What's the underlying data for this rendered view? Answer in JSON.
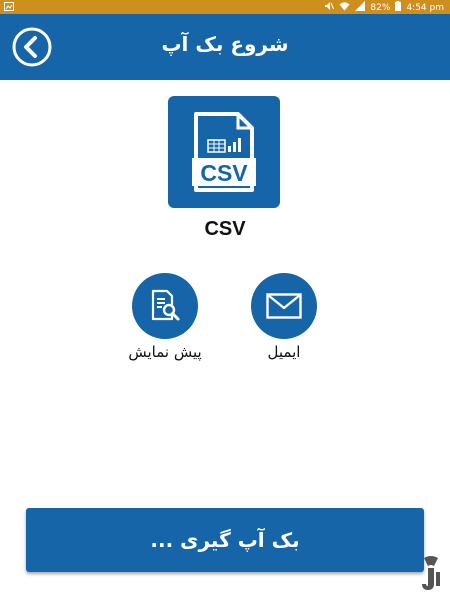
{
  "status_bar": {
    "battery": "82%",
    "time": "4:54 pm"
  },
  "header": {
    "title": "شروع بک آپ",
    "back_icon": "back-arrow-icon"
  },
  "file": {
    "icon": "csv-file-icon",
    "type_label": "CSV"
  },
  "actions": [
    {
      "id": "preview",
      "icon": "document-search-icon",
      "label": "پیش نمایش"
    },
    {
      "id": "email",
      "icon": "envelope-icon",
      "label": "ایمیل"
    }
  ],
  "backup_button": {
    "label": "بک آپ گیری ..."
  },
  "colors": {
    "primary": "#1565a8",
    "status_bar": "#cf8f1f",
    "background": "#ffffff"
  }
}
